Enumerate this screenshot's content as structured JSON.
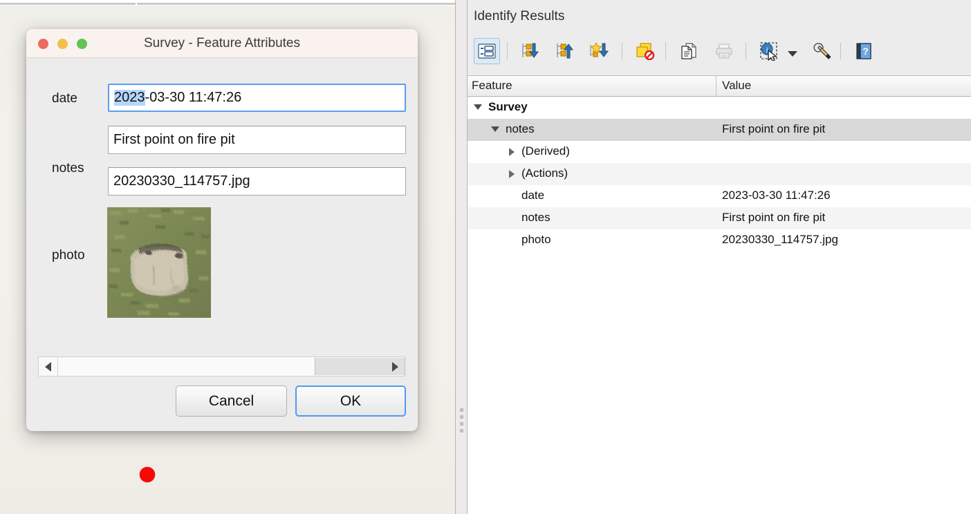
{
  "map": {
    "marker_color": "#fb0505",
    "background_color": "#f2f0ea"
  },
  "dialog": {
    "title": "Survey - Feature Attributes",
    "traffic_lights": {
      "close": "close-button",
      "minimize": "minimize-button",
      "maximize": "maximize-button",
      "close_color": "#ed6a5e",
      "minimize_color": "#f4be4f",
      "maximize_color": "#61c454"
    },
    "fields": [
      {
        "label": "date",
        "value": "2023-03-30 11:47:26",
        "selected_part": "2023",
        "rest_part": "-03-30 11:47:26",
        "focused": true
      },
      {
        "label": "notes",
        "value": "First point on fire pit",
        "focused": false
      },
      {
        "label": "",
        "value": "20230330_114757.jpg",
        "focused": false
      }
    ],
    "photo_label": "photo",
    "photo_filename": "20230330_114757.jpg",
    "scrollbar": {
      "left_arrow": "scroll-left-arrow",
      "right_arrow": "scroll-right-arrow"
    },
    "buttons": {
      "cancel": "Cancel",
      "ok": "OK",
      "default_button": "OK",
      "focus_color": "#4e9bf0"
    },
    "selection_color": "#b4d5fe"
  },
  "identify": {
    "panel_title": "Identify Results",
    "toolbar": [
      {
        "name": "tree-list-view-icon",
        "title": "Tree/Table view",
        "selected": true,
        "enabled": true
      },
      {
        "name": "expand-all-icon",
        "title": "Expand all",
        "selected": false,
        "enabled": true
      },
      {
        "name": "collapse-all-icon",
        "title": "Collapse all",
        "selected": false,
        "enabled": true
      },
      {
        "name": "expand-new-results-icon",
        "title": "Expand new results by default",
        "selected": false,
        "enabled": true
      },
      {
        "name": "clear-results-icon",
        "title": "Clear results",
        "selected": false,
        "enabled": true
      },
      {
        "name": "copy-icon",
        "title": "Copy",
        "selected": false,
        "enabled": true
      },
      {
        "name": "print-icon",
        "title": "Print",
        "selected": false,
        "enabled": false
      },
      {
        "name": "identify-mode-icon",
        "title": "Identify feature(s)",
        "selected": false,
        "enabled": true
      },
      {
        "name": "identify-dropdown-caret-icon",
        "title": "Identify mode menu",
        "selected": false,
        "enabled": true
      },
      {
        "name": "settings-wrench-icon",
        "title": "Identify settings",
        "selected": false,
        "enabled": true
      },
      {
        "name": "help-icon",
        "title": "Help",
        "selected": false,
        "enabled": true
      }
    ],
    "columns": {
      "feature": "Feature",
      "value": "Value"
    },
    "rows": [
      {
        "label": "Survey",
        "value": "",
        "indent": 0,
        "twisty": "open",
        "bold": true,
        "stripe": "white",
        "selected": false
      },
      {
        "label": "notes",
        "value": "First point on fire pit",
        "indent": 1,
        "twisty": "open",
        "bold": false,
        "stripe": "selected",
        "selected": true
      },
      {
        "label": "(Derived)",
        "value": "",
        "indent": 2,
        "twisty": "closed",
        "bold": false,
        "stripe": "white",
        "selected": false
      },
      {
        "label": "(Actions)",
        "value": "",
        "indent": 2,
        "twisty": "closed",
        "bold": false,
        "stripe": "alt",
        "selected": false
      },
      {
        "label": "date",
        "value": "2023-03-30 11:47:26",
        "indent": 3,
        "twisty": "none",
        "bold": false,
        "stripe": "white",
        "selected": false
      },
      {
        "label": "notes",
        "value": "First point on fire pit",
        "indent": 3,
        "twisty": "none",
        "bold": false,
        "stripe": "alt",
        "selected": false
      },
      {
        "label": "photo",
        "value": "20230330_114757.jpg",
        "indent": 3,
        "twisty": "none",
        "bold": false,
        "stripe": "white",
        "selected": false
      }
    ],
    "selected_row_color": "#d8d8d8",
    "alt_row_color": "#f4f4f4"
  }
}
